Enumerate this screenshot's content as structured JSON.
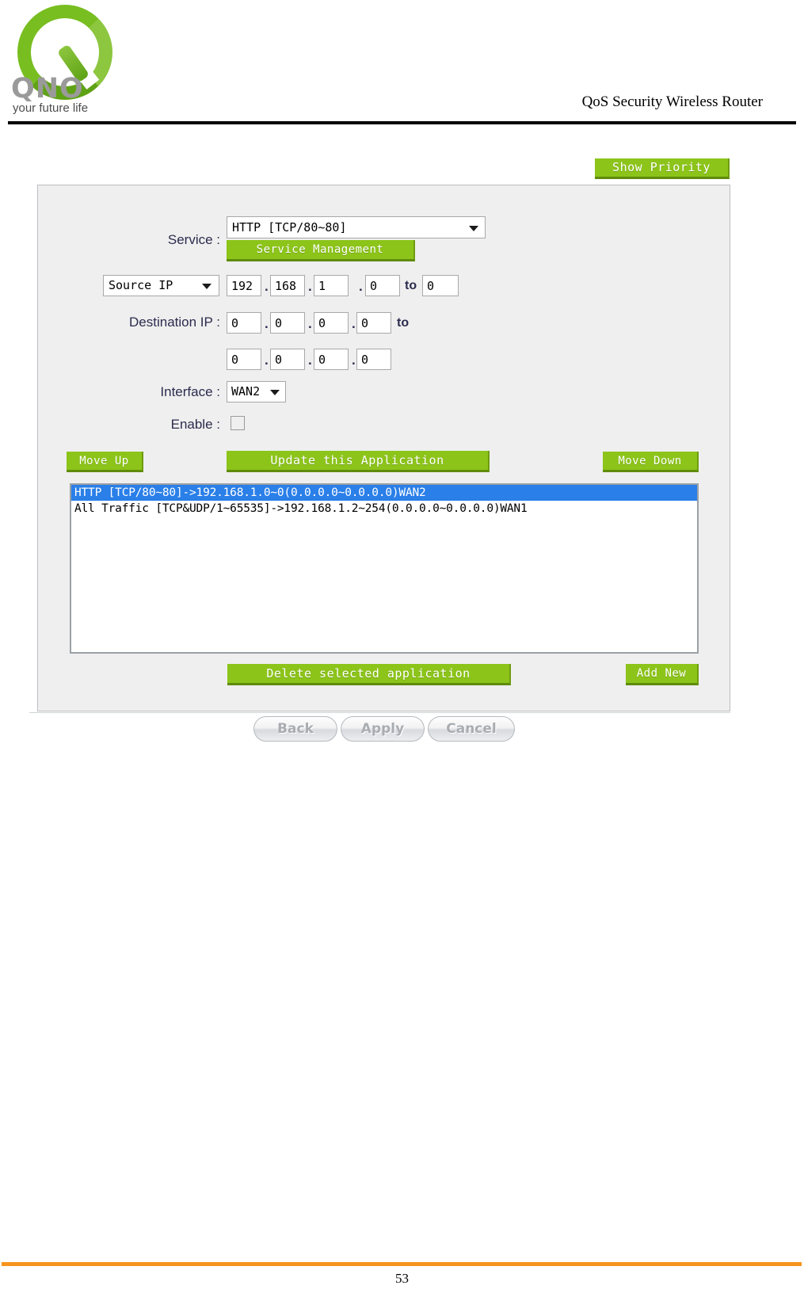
{
  "header": {
    "logo_wordmark": "QNO",
    "logo_tagline": "your future life",
    "title": "QoS Security Wireless Router"
  },
  "toolbar": {
    "show_priority_label": "Show Priority"
  },
  "form": {
    "service": {
      "label": "Service :",
      "selected": "HTTP [TCP/80~80]",
      "manage_button": "Service Management"
    },
    "source_ip": {
      "type_selected": "Source IP",
      "octets": [
        "192",
        "168",
        "1",
        "0"
      ],
      "to_label": "to",
      "range_end": "0"
    },
    "destination_ip": {
      "label": "Destination IP :",
      "start_octets": [
        "0",
        "0",
        "0",
        "0"
      ],
      "to_label": "to",
      "end_octets": [
        "0",
        "0",
        "0",
        "0"
      ]
    },
    "interface": {
      "label": "Interface :",
      "selected": "WAN2"
    },
    "enable": {
      "label": "Enable :",
      "checked": false
    }
  },
  "actions": {
    "move_up": "Move Up",
    "update_application": "Update this Application",
    "move_down": "Move Down",
    "delete_application": "Delete selected application",
    "add_new": "Add New"
  },
  "rule_list": {
    "items": [
      {
        "text": "HTTP [TCP/80~80]->192.168.1.0~0(0.0.0.0~0.0.0.0)WAN2",
        "selected": true
      },
      {
        "text": "All Traffic [TCP&UDP/1~65535]->192.168.1.2~254(0.0.0.0~0.0.0.0)WAN1",
        "selected": false
      }
    ]
  },
  "footer_buttons": {
    "back": "Back",
    "apply": "Apply",
    "cancel": "Cancel"
  },
  "footer": {
    "page_number": "53"
  },
  "colors": {
    "button_green": "#8CC41A",
    "selection_blue": "#2A7FE8",
    "panel_grey": "#EFEFEF",
    "footer_orange": "#F7941E",
    "label_navy": "#2B2B4F"
  }
}
